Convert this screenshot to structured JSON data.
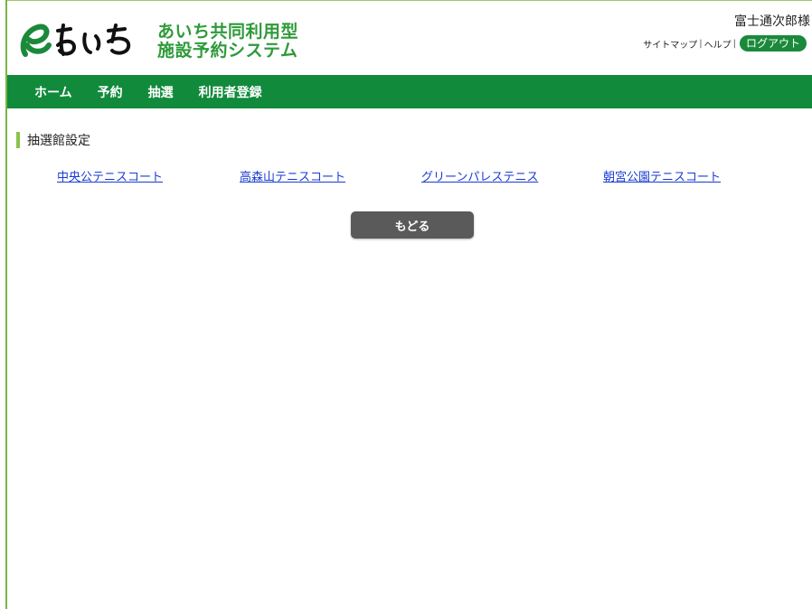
{
  "header": {
    "site_title_line1": "あいち共同利用型",
    "site_title_line2": "施設予約システム",
    "user_name": "富士通次郎様",
    "links": {
      "sitemap": "サイトマップ",
      "help": "ヘルプ",
      "logout": "ログアウト"
    }
  },
  "nav": {
    "items": [
      "ホーム",
      "予約",
      "抽選",
      "利用者登録"
    ]
  },
  "main": {
    "section_title": "抽選館設定",
    "facilities": [
      "中央公テニスコート",
      "高森山テニスコート",
      "グリーンパレステニス",
      "朝宮公園テニスコート"
    ],
    "back_label": "もどる"
  },
  "colors": {
    "brand_green": "#118a3c",
    "title_green": "#2e9a3a",
    "link_blue": "#1a3bd6",
    "accent_bar": "#8bc34a"
  }
}
